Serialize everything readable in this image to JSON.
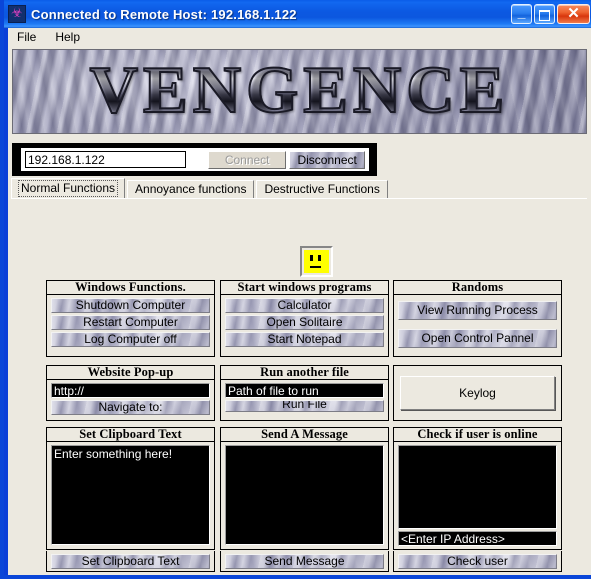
{
  "window": {
    "title": "Connected to Remote Host: 192.168.1.122",
    "icon": "spider-icon",
    "minimize": "_",
    "maximize": "",
    "close": "✕"
  },
  "menubar": {
    "items": [
      {
        "label": "File"
      },
      {
        "label": "Help"
      }
    ]
  },
  "banner": {
    "text": "VENGENCE"
  },
  "connection": {
    "ip_value": "192.168.1.122",
    "ip_placeholder": "",
    "connect_label": "Connect",
    "connect_enabled": false,
    "disconnect_label": "Disconnect",
    "disconnect_enabled": true
  },
  "tabs": [
    {
      "label": "Normal Functions",
      "active": true
    },
    {
      "label": "Annoyance functions",
      "active": false
    },
    {
      "label": "Destructive Functions",
      "active": false
    }
  ],
  "status_face": {
    "name": "neutral-face-icon",
    "color": "#ffff00"
  },
  "sections": {
    "windows_functions": {
      "title": "Windows Functions.",
      "buttons": [
        {
          "label": "Shutdown Computer"
        },
        {
          "label": "Restart Computer"
        },
        {
          "label": "Log Computer off"
        }
      ]
    },
    "start_windows_programs": {
      "title": "Start windows programs",
      "buttons": [
        {
          "label": "Calculator"
        },
        {
          "label": "Open Solitaire"
        },
        {
          "label": "Start Notepad"
        }
      ]
    },
    "randoms": {
      "title": "Randoms",
      "buttons": [
        {
          "label": "View Running Process"
        },
        {
          "label": "Open Control Pannel"
        }
      ]
    },
    "website_popup": {
      "title": "Website Pop-up",
      "url_value": "http://",
      "url_placeholder": "http://",
      "button_label": "Navigate to:"
    },
    "run_another_file": {
      "title": "Run another file",
      "path_value": "Path of file to run",
      "path_placeholder": "Path of file to run",
      "button_label": "Run File"
    },
    "keylog": {
      "button_label": "Keylog"
    },
    "set_clipboard_text": {
      "title": "Set Clipboard Text",
      "textarea_value": "Enter something here!",
      "button_label": "Set Clipboard Text"
    },
    "send_a_message": {
      "title": "Send A Message",
      "textarea_value": "",
      "button_label": "Send Message"
    },
    "check_if_user_is_online": {
      "title": "Check if user is online",
      "textarea_value": "",
      "ip_value": "<Enter IP Address>",
      "ip_placeholder": "<Enter IP Address>",
      "button_label": "Check user"
    }
  },
  "colors": {
    "titlebar_blue": "#0c57df",
    "frame_blue": "#0a46d8",
    "dialog_face": "#ece9e0",
    "field_black": "#000000",
    "smiley_yellow": "#ffff00",
    "close_red": "#d8360c"
  }
}
